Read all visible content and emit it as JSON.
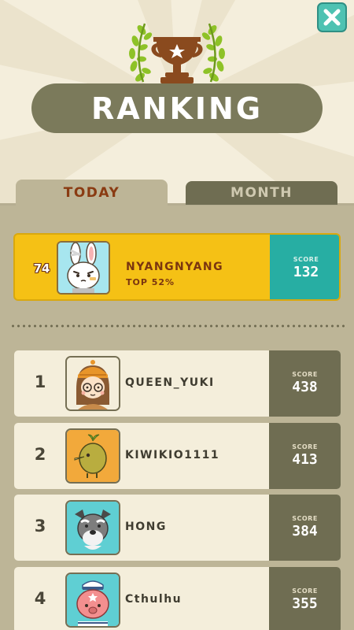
{
  "title": "RANKING",
  "tabs": [
    {
      "label": "TODAY",
      "active": true
    },
    {
      "label": "MONTH",
      "active": false
    }
  ],
  "me": {
    "rank": "74",
    "name": "NYANGNYANG",
    "top": "TOP 52%",
    "score_label": "SCORE",
    "score": "132"
  },
  "leaderboard": [
    {
      "rank": "1",
      "name": "QUEEN_YUKI",
      "score_label": "SCORE",
      "score": "438"
    },
    {
      "rank": "2",
      "name": "KIWIKIO1111",
      "score_label": "SCORE",
      "score": "413"
    },
    {
      "rank": "3",
      "name": "HONG",
      "score_label": "SCORE",
      "score": "384"
    },
    {
      "rank": "4",
      "name": "Cthulhu",
      "score_label": "SCORE",
      "score": "355"
    }
  ],
  "icons": {
    "close": "close-icon",
    "trophy": "trophy-icon",
    "avatars": [
      "bunny-avatar",
      "girl-with-glasses-avatar",
      "kiwi-bird-avatar",
      "schnauzer-dog-avatar",
      "octopus-sailor-avatar"
    ]
  },
  "colors": {
    "background": "#f4eedc",
    "banner": "#7b7a5b",
    "highlight_row": "#f5c115",
    "highlight_score": "#27aea3",
    "score_box": "#6f6d52",
    "close_button": "#4ec2b2"
  }
}
